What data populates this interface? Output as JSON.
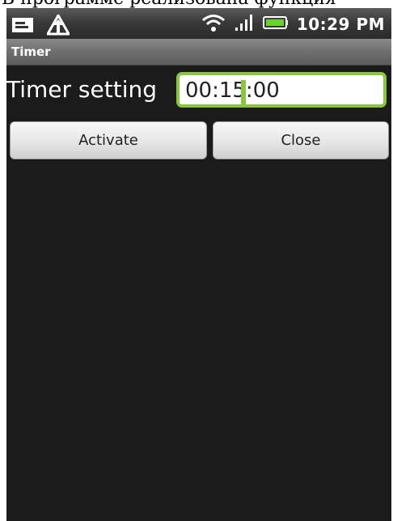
{
  "document": {
    "caption_fragment": "В программе реализована функция"
  },
  "status_bar": {
    "time": "10:29 PM",
    "left_icons": [
      "notification-icon",
      "upload-icon"
    ],
    "right_icons": [
      "wifi-icon",
      "signal-icon",
      "battery-icon"
    ]
  },
  "window": {
    "title": "Timer"
  },
  "form": {
    "label": "Timer setting",
    "value": "00:15:00",
    "accent_color": "#8cc63f"
  },
  "buttons": {
    "activate": "Activate",
    "close": "Close"
  }
}
